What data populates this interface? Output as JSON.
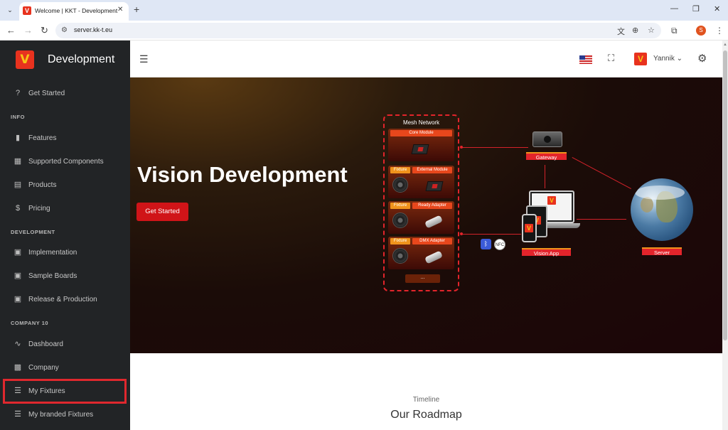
{
  "browser": {
    "tab_title": "Welcome | KKT - Development",
    "url": "server.kk-t.eu"
  },
  "sidebar": {
    "brand": "Development",
    "items": [
      {
        "label": "Get Started",
        "icon": "question-circle-icon"
      },
      {
        "section": "INFO"
      },
      {
        "label": "Features",
        "icon": "bookmark-icon"
      },
      {
        "label": "Supported Components",
        "icon": "grid-icon"
      },
      {
        "label": "Products",
        "icon": "book-icon"
      },
      {
        "label": "Pricing",
        "icon": "dollar-icon"
      },
      {
        "section": "DEVELOPMENT"
      },
      {
        "label": "Implementation",
        "icon": "chip-icon"
      },
      {
        "label": "Sample Boards",
        "icon": "chip-icon"
      },
      {
        "label": "Release & Production",
        "icon": "chip-icon"
      },
      {
        "section": "COMPANY 10"
      },
      {
        "label": "Dashboard",
        "icon": "line-chart-icon"
      },
      {
        "label": "Company",
        "icon": "contact-card-icon"
      },
      {
        "label": "My Fixtures",
        "icon": "list-icon"
      },
      {
        "label": "My branded Fixtures",
        "icon": "list-icon"
      }
    ]
  },
  "header": {
    "username": "Yannik",
    "language": "en-US"
  },
  "hero": {
    "title": "Vision Development",
    "cta": "Get Started",
    "diagram": {
      "mesh_title": "Mesh Network",
      "core_module": "Core Module",
      "fixture": "Fixture",
      "external_module": "External Module",
      "ready_adapter": "Ready Adapter",
      "dmx_adapter": "DMX Adapter",
      "more": "...",
      "gateway": "Gateway",
      "vision_app": "Vision App",
      "server": "Server",
      "nfc": "NFC"
    }
  },
  "content": {
    "timeline_label": "Timeline",
    "roadmap_title": "Our Roadmap"
  },
  "colors": {
    "sidebar_bg": "#222426",
    "accent_red": "#d01418",
    "highlight_box": "#e0282e"
  }
}
